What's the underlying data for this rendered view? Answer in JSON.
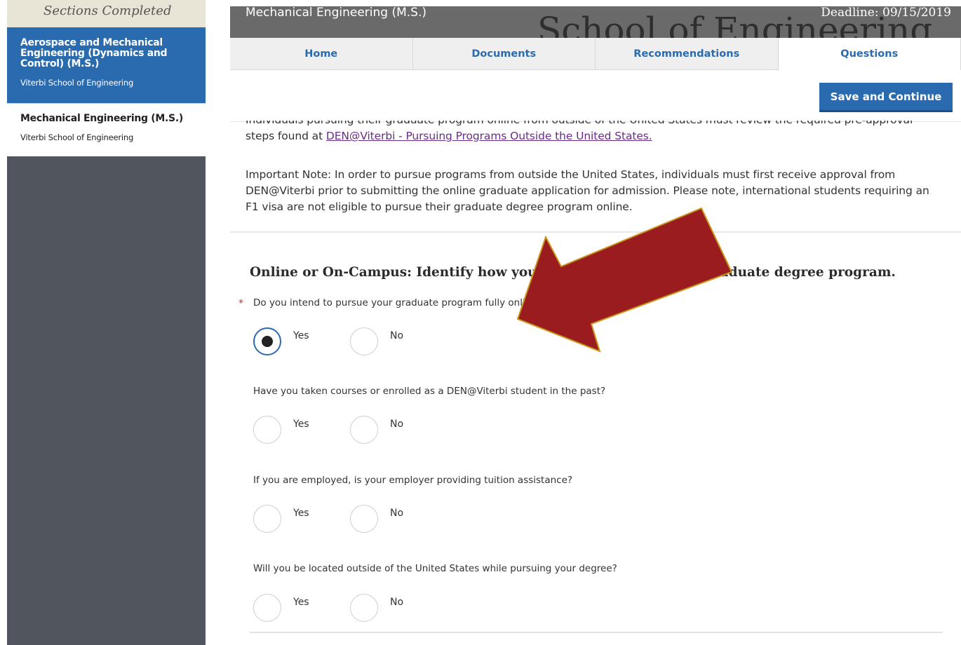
{
  "sidebar": {
    "heading": "Sections Completed",
    "items": [
      {
        "title": "Aerospace and Mechanical Engineering (Dynamics and Control) (M.S.)",
        "subtitle": "Viterbi School of Engineering",
        "selected": true
      },
      {
        "title": "Mechanical Engineering (M.S.)",
        "subtitle": "Viterbi School of Engineering",
        "selected": false
      }
    ]
  },
  "header": {
    "program": "Mechanical Engineering (M.S.)",
    "deadline": "Deadline: 09/15/2019",
    "watermark": "School of Engineering"
  },
  "tabs": [
    {
      "label": "Home",
      "active": false
    },
    {
      "label": "Documents",
      "active": false
    },
    {
      "label": "Recommendations",
      "active": false
    },
    {
      "label": "Questions",
      "active": true
    }
  ],
  "toolbar": {
    "save_label": "Save and Continue"
  },
  "content": {
    "para1_cut": "Individuals pursuing their graduate program online from outside of the United States must review the required pre-approval",
    "para1_prefix": "steps found at ",
    "para1_link": "DEN@Viterbi - Pursuing Programs Outside the United States. ",
    "para2": "Important Note: In order to pursue programs from outside the United States, individuals must first receive approval from DEN@Viterbi prior to submitting the online graduate application for admission. Please note, international students requiring an F1 visa are not eligible to pursue their graduate degree program online.",
    "section_title": "Online or On-Campus: Identify how you intend to pursue your graduate degree program.",
    "required_marker": "*",
    "questions": [
      {
        "label": "Do you intend to pursue your graduate program fully online?",
        "required": true,
        "yes": "Yes",
        "no": "No",
        "selected": "Yes"
      },
      {
        "label": "Have you taken courses or enrolled as a DEN@Viterbi student in the past?",
        "required": false,
        "yes": "Yes",
        "no": "No",
        "selected": null
      },
      {
        "label": "If you are employed, is your employer providing tuition assistance?",
        "required": false,
        "yes": "Yes",
        "no": "No",
        "selected": null
      },
      {
        "label": "Will you be located outside of the United States while pursuing your degree?",
        "required": false,
        "yes": "Yes",
        "no": "No",
        "selected": null
      }
    ]
  },
  "colors": {
    "accent": "#2a6bb0",
    "sidebar_bg": "#51565e",
    "annotation_arrow": "#9b1c1f"
  }
}
